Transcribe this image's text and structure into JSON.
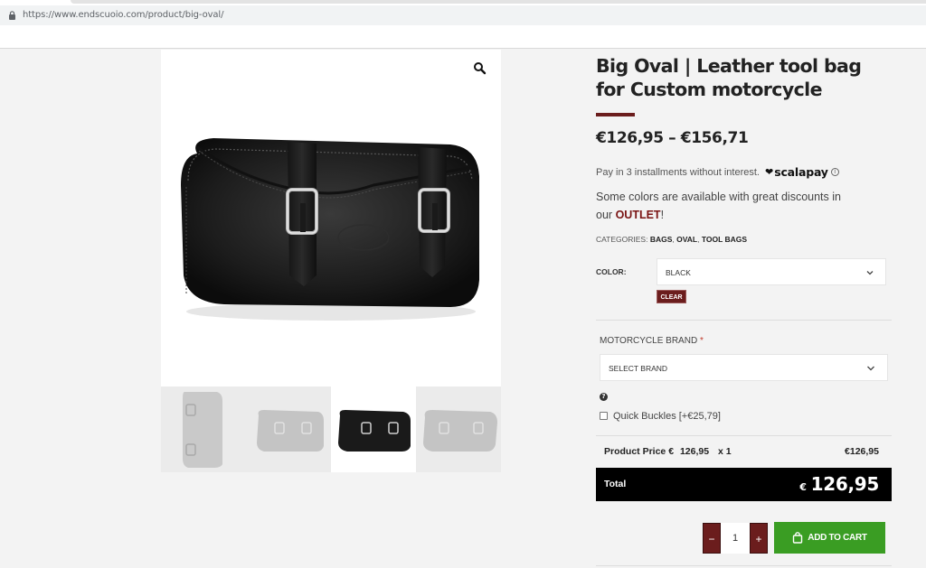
{
  "browser": {
    "url": "https://www.endscuoio.com/product/big-oval/"
  },
  "gallery": {
    "zoom_icon": "search-icon",
    "thumbnails": [
      "bag-upright-thumbnail",
      "bag-front-faded-thumbnail",
      "bag-black-thumbnail",
      "bag-side-faded-thumbnail"
    ]
  },
  "product": {
    "title": "Big Oval | Leather tool bag for Custom motorcycle",
    "price": "€126,95 – €156,71",
    "installments_text": "Pay in 3 installments without interest.",
    "scalapay_label": "scalapay",
    "discount_text": "Some colors are available with great discounts in our",
    "discount_link": "OUTLET",
    "discount_suffix": "!",
    "categories_label": "Categories:",
    "categories": [
      "Bags",
      "Oval",
      "Tool bags"
    ],
    "color_label": "Color:",
    "color_value": "BLACK",
    "clear_label": "Clear",
    "brand_label": "Motorcycle Brand",
    "brand_required": "*",
    "brand_value": "SELECT BRAND",
    "addon_label": "Quick Buckles [+€25,79]",
    "product_price_label": "Product Price €",
    "product_price_value": "126,95",
    "product_price_qty": "x 1",
    "product_price_total": "€126,95",
    "total_label": "Total",
    "total_currency": "€",
    "total_value": "126,95",
    "qty_minus": "−",
    "qty_plus": "+",
    "qty_value": "1",
    "add_to_cart_label": "Add to cart"
  },
  "colors": {
    "accent": "#6b1d1d",
    "outlet": "#7a1414",
    "cart_green": "#3a9d23",
    "total_bg": "#000000"
  }
}
